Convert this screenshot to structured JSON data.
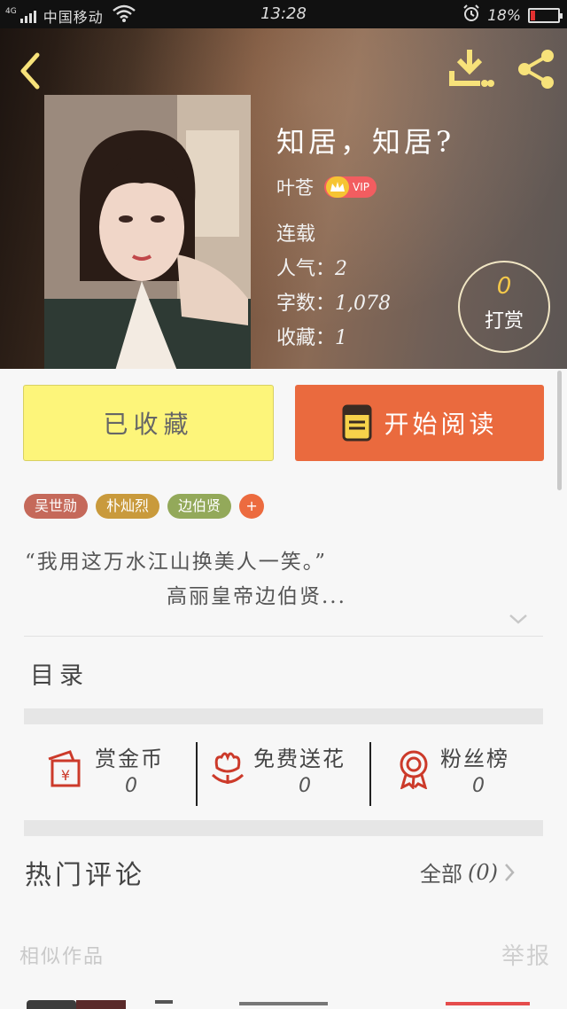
{
  "status_bar": {
    "network": "4G",
    "carrier": "中国移动",
    "time": "13:28",
    "battery": "18%",
    "battery_level": 0.18
  },
  "header": {
    "icons": {
      "back": "back-chevron-icon",
      "download": "download-icon",
      "share": "share-icon"
    }
  },
  "book": {
    "title": "知居，知居?",
    "author": "叶苍",
    "vip_label": "VIP",
    "status": "连载",
    "popularity_label": "人气：",
    "popularity": "2",
    "word_count_label": "字数：",
    "word_count": "1,078",
    "favorites_label": "收藏：",
    "favorites": "1"
  },
  "reward": {
    "count": "0",
    "label": "打赏"
  },
  "actions": {
    "collected_label": "已收藏",
    "read_label": "开始阅读",
    "colors": {
      "collected": "#fdf57a",
      "read": "#ea6a3e"
    }
  },
  "tags": [
    {
      "label": "吴世勋",
      "color": "#c5695a"
    },
    {
      "label": "朴灿烈",
      "color": "#c99a3c"
    },
    {
      "label": "边伯贤",
      "color": "#93a95a"
    }
  ],
  "tag_add": "+",
  "intro": {
    "line1": "“我用这万水江山换美人一笑。”",
    "line2": "高丽皇帝边伯贤..."
  },
  "toc": {
    "heading": "目录"
  },
  "stats": {
    "coin_label": "赏金币",
    "coin_value": "0",
    "flower_label": "免费送花",
    "flower_value": "0",
    "fans_label": "粉丝榜",
    "fans_value": "0"
  },
  "comments": {
    "heading": "热门评论",
    "all_prefix": "全部",
    "all_count": "(0)"
  },
  "similar": {
    "heading": "相似作品",
    "report": "举报"
  }
}
